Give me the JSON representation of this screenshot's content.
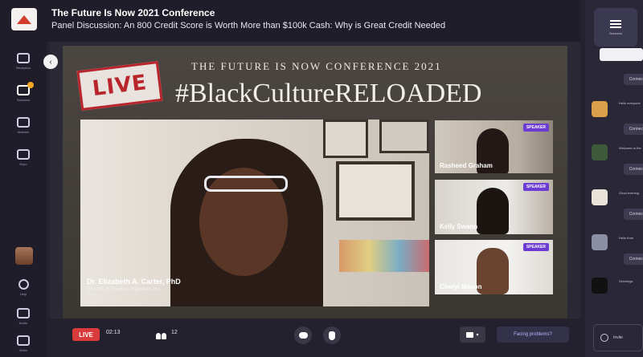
{
  "header": {
    "event_title": "The Future Is Now 2021 Conference",
    "session_title": "Panel Discussion: An 800 Credit Score is Worth More than $100k Cash: Why is Great Credit Needed"
  },
  "left_rail": {
    "items": [
      {
        "label": "Reception",
        "icon": "reception-icon"
      },
      {
        "label": "Sessions",
        "icon": "sessions-icon"
      },
      {
        "label": "Network",
        "icon": "network-icon"
      },
      {
        "label": "Expo",
        "icon": "expo-icon"
      }
    ],
    "bottom_items": [
      {
        "label": "Help",
        "icon": "help-icon"
      },
      {
        "label": "Audio",
        "icon": "audio-icon"
      },
      {
        "label": "Video",
        "icon": "video-icon"
      }
    ]
  },
  "stage": {
    "live_stamp": "LIVE",
    "conference_banner": "THE FUTURE IS NOW CONFERENCE 2021",
    "hashtag": "#BlackCultureRELOADED",
    "main_speaker": {
      "name": "Dr. Elizabeth A. Carter, PhD",
      "role": "Director of Finance, Highmark, Inc.",
      "location": "USA"
    },
    "speaker_badge": "SPEAKER",
    "tiles": [
      {
        "name": "Rasheed Graham"
      },
      {
        "name": "Kelly Swann"
      },
      {
        "name": "Cheryl Mason"
      }
    ]
  },
  "controls": {
    "live_label": "LIVE",
    "timer": "02:13",
    "viewer_count": "12",
    "problem_label": "Facing problems?"
  },
  "right_panel": {
    "tab_label": "Sessions",
    "entries": [
      {
        "text": "Hello everyone",
        "action": "Connect"
      },
      {
        "text": "Welcome to the",
        "action": "Connect"
      },
      {
        "text": "Good evening",
        "action": "Connect"
      },
      {
        "text": "Hello from",
        "action": "Connect"
      },
      {
        "text": "Greetings",
        "action": "Connect"
      }
    ],
    "footer_label": "Invite"
  },
  "colors": {
    "accent": "#6b3bd4",
    "live_red": "#d93b3b",
    "background": "#24222f"
  }
}
